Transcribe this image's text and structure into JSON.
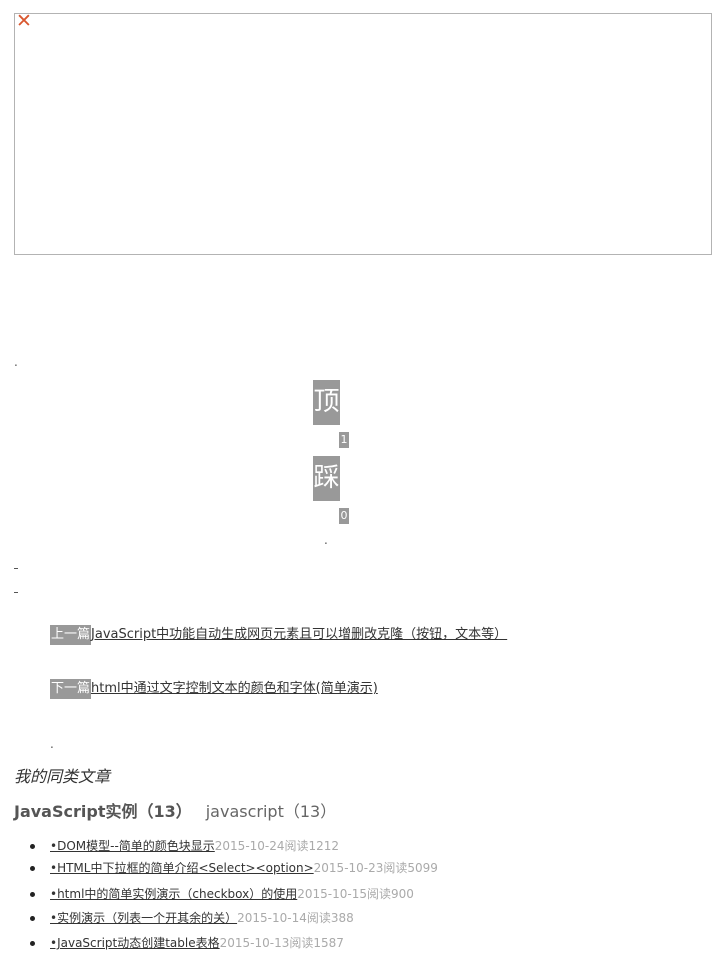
{
  "ad": {
    "close_glyph": "✕"
  },
  "dots": {
    "d1": ".",
    "d2": ".",
    "d3": "."
  },
  "vote": {
    "up_label": "顶",
    "up_count": "1",
    "down_label": "踩",
    "down_count": "0"
  },
  "nav": {
    "prev_tag": "上一篇",
    "prev_title": "JavaScript中功能自动生成网页元素且可以增删改克隆（按钮，文本等）",
    "next_tag": "下一篇",
    "next_title": "html中通过文字控制文本的颜色和字体(简单演示)"
  },
  "related": {
    "title": "我的同类文章",
    "categories": [
      {
        "label": "JavaScript实例（13）"
      },
      {
        "label": "javascript（13）"
      }
    ],
    "articles": [
      {
        "title": "•DOM模型--简单的颜色块显示",
        "date": "2015-10-24",
        "reads": "阅读1212"
      },
      {
        "title": "•HTML中下拉框的简单介绍<Select><option>",
        "date": "2015-10-23",
        "reads": "阅读5099"
      },
      {
        "title": "•html中的简单实例演示（checkbox）的使用",
        "date": "2015-10-15",
        "reads": "阅读900"
      },
      {
        "title": "•实例演示（列表一个开其余的关）",
        "date": "2015-10-14",
        "reads": "阅读388"
      },
      {
        "title": "•JavaScript动态创建table表格",
        "date": "2015-10-13",
        "reads": "阅读1587"
      }
    ]
  }
}
